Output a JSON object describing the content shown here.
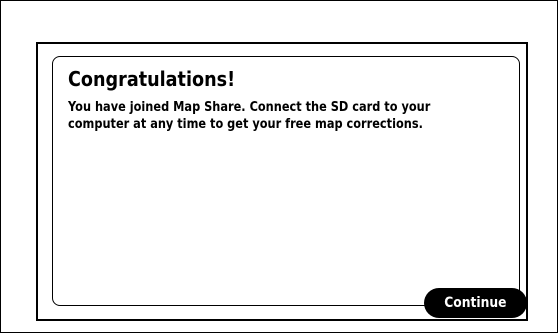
{
  "dialog": {
    "title": "Congratulations!",
    "message_line1": "You have joined Map Share. Connect the SD card to your",
    "message_line2": "computer at any time to get your free map corrections."
  },
  "actions": {
    "continue_label": "Continue"
  },
  "colors": {
    "background": "#ffffff",
    "text": "#000000",
    "button_background": "#000000",
    "button_text": "#ffffff"
  }
}
